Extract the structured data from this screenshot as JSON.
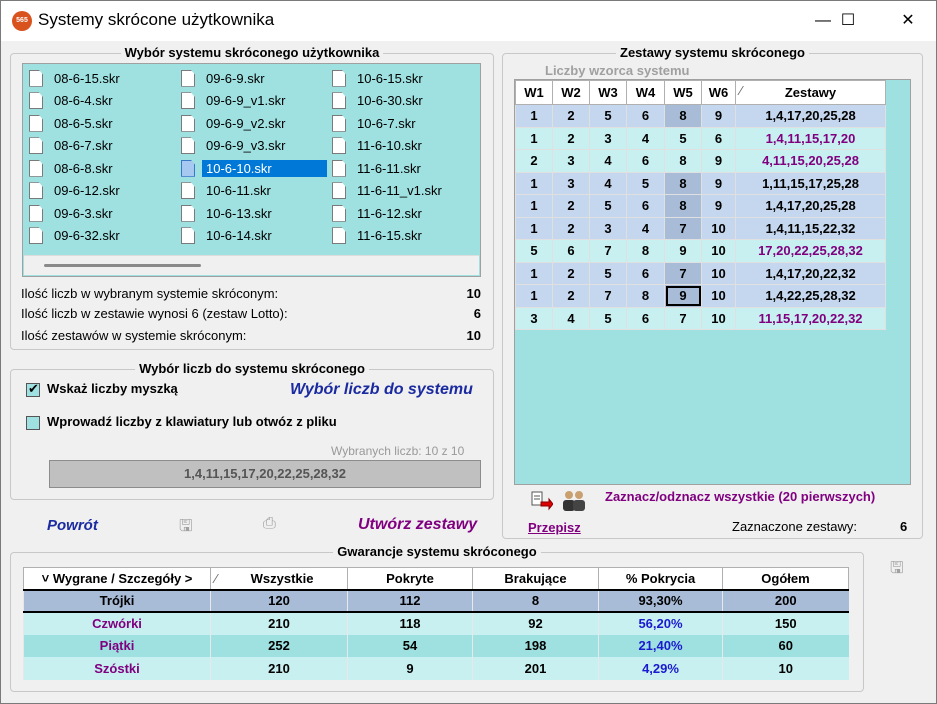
{
  "window": {
    "title": "Systemy skrócone użytkownika",
    "app_icon_text": "565",
    "minimize": "—",
    "maximize": "☐",
    "close": "✕"
  },
  "left_group": {
    "title": "Wybór systemu skróconego użytkownika",
    "files": [
      [
        "08-6-15.skr",
        "08-6-4.skr",
        "08-6-5.skr",
        "08-6-7.skr",
        "08-6-8.skr",
        "09-6-12.skr",
        "09-6-3.skr",
        "09-6-32.skr"
      ],
      [
        "09-6-9.skr",
        "09-6-9_v1.skr",
        "09-6-9_v2.skr",
        "09-6-9_v3.skr",
        "10-6-10.skr",
        "10-6-11.skr",
        "10-6-13.skr",
        "10-6-14.skr"
      ],
      [
        "10-6-15.skr",
        "10-6-30.skr",
        "10-6-7.skr",
        "11-6-10.skr",
        "11-6-11.skr",
        "11-6-11_v1.skr",
        "11-6-12.skr",
        "11-6-15.skr"
      ]
    ],
    "selected_file": "10-6-10.skr",
    "info": [
      {
        "label": "Ilość liczb w wybranym systemie skróconym:",
        "value": "10"
      },
      {
        "label": "Ilość liczb w zestawie wynosi 6 (zestaw Lotto):",
        "value": "6"
      },
      {
        "label": "Ilość zestawów w systemie skróconym:",
        "value": "10"
      }
    ]
  },
  "numbers_group": {
    "title": "Wybór liczb do systemu skróconego",
    "mouse_label": "Wskaż liczby myszką",
    "mouse_checked": true,
    "keyboard_label": "Wprowadź liczby z klawiatury lub otwóz z pliku",
    "keyboard_checked": false,
    "choose_link": "Wybór liczb do systemu",
    "selected_count": "Wybranych liczb: 10 z 10",
    "selected_numbers": "1,4,11,15,17,20,22,25,28,32"
  },
  "actions": {
    "back": "Powrót",
    "create": "Utwórz zestawy",
    "save_icon": "floppy-icon",
    "print_icon": "printer-icon"
  },
  "sets_group": {
    "title": "Zestawy systemu skróconego",
    "pattern_label": "Liczby wzorca systemu",
    "headers": [
      "W1",
      "W2",
      "W3",
      "W4",
      "W5",
      "W6",
      "Zestawy"
    ],
    "sort_mark": "⁄",
    "rows": [
      {
        "w": [
          "1",
          "2",
          "5",
          "6",
          "8",
          "9"
        ],
        "z": "1,4,17,20,25,28",
        "hl": true,
        "purple": false
      },
      {
        "w": [
          "1",
          "2",
          "3",
          "4",
          "5",
          "6"
        ],
        "z": "1,4,11,15,17,20",
        "hl": false,
        "purple": true
      },
      {
        "w": [
          "2",
          "3",
          "4",
          "6",
          "8",
          "9"
        ],
        "z": "4,11,15,20,25,28",
        "hl": false,
        "purple": true
      },
      {
        "w": [
          "1",
          "3",
          "4",
          "5",
          "8",
          "9"
        ],
        "z": "1,11,15,17,25,28",
        "hl": true,
        "purple": false
      },
      {
        "w": [
          "1",
          "2",
          "5",
          "6",
          "8",
          "9"
        ],
        "z": "1,4,17,20,25,28",
        "hl": true,
        "purple": false
      },
      {
        "w": [
          "1",
          "2",
          "3",
          "4",
          "7",
          "10"
        ],
        "z": "1,4,11,15,22,32",
        "hl": true,
        "purple": false
      },
      {
        "w": [
          "5",
          "6",
          "7",
          "8",
          "9",
          "10"
        ],
        "z": "17,20,22,25,28,32",
        "hl": false,
        "purple": true
      },
      {
        "w": [
          "1",
          "2",
          "5",
          "6",
          "7",
          "10"
        ],
        "z": "1,4,17,20,22,32",
        "hl": true,
        "purple": false
      },
      {
        "w": [
          "1",
          "2",
          "7",
          "8",
          "9",
          "10"
        ],
        "z": "1,4,22,25,28,32",
        "hl": true,
        "purple": false
      },
      {
        "w": [
          "3",
          "4",
          "5",
          "6",
          "7",
          "10"
        ],
        "z": "11,15,17,20,22,32",
        "hl": false,
        "purple": true
      }
    ],
    "toggle_all": "Zaznacz/odznacz wszystkie (20 pierwszych)",
    "copy_label": "Przepisz",
    "marked_label": "Zaznaczone zestawy:",
    "marked_value": "6"
  },
  "guarantee_group": {
    "title": "Gwarancje systemu skróconego",
    "headers": [
      "Wygrane / Szczegóły >",
      "Wszystkie",
      "Pokryte",
      "Brakujące",
      "% Pokrycia",
      "Ogółem"
    ],
    "rows": [
      [
        "Trójki",
        "120",
        "112",
        "8",
        "93,30%",
        "200"
      ],
      [
        "Czwórki",
        "210",
        "118",
        "92",
        "56,20%",
        "150"
      ],
      [
        "Piątki",
        "252",
        "54",
        "198",
        "21,40%",
        "60"
      ],
      [
        "Szóstki",
        "210",
        "9",
        "201",
        "4,29%",
        "10"
      ]
    ]
  },
  "colors": {
    "list_bg": "#9fe0e0",
    "highlight_row": "#c5d7ee",
    "purple": "#800080",
    "blue": "#1a1ad0"
  }
}
